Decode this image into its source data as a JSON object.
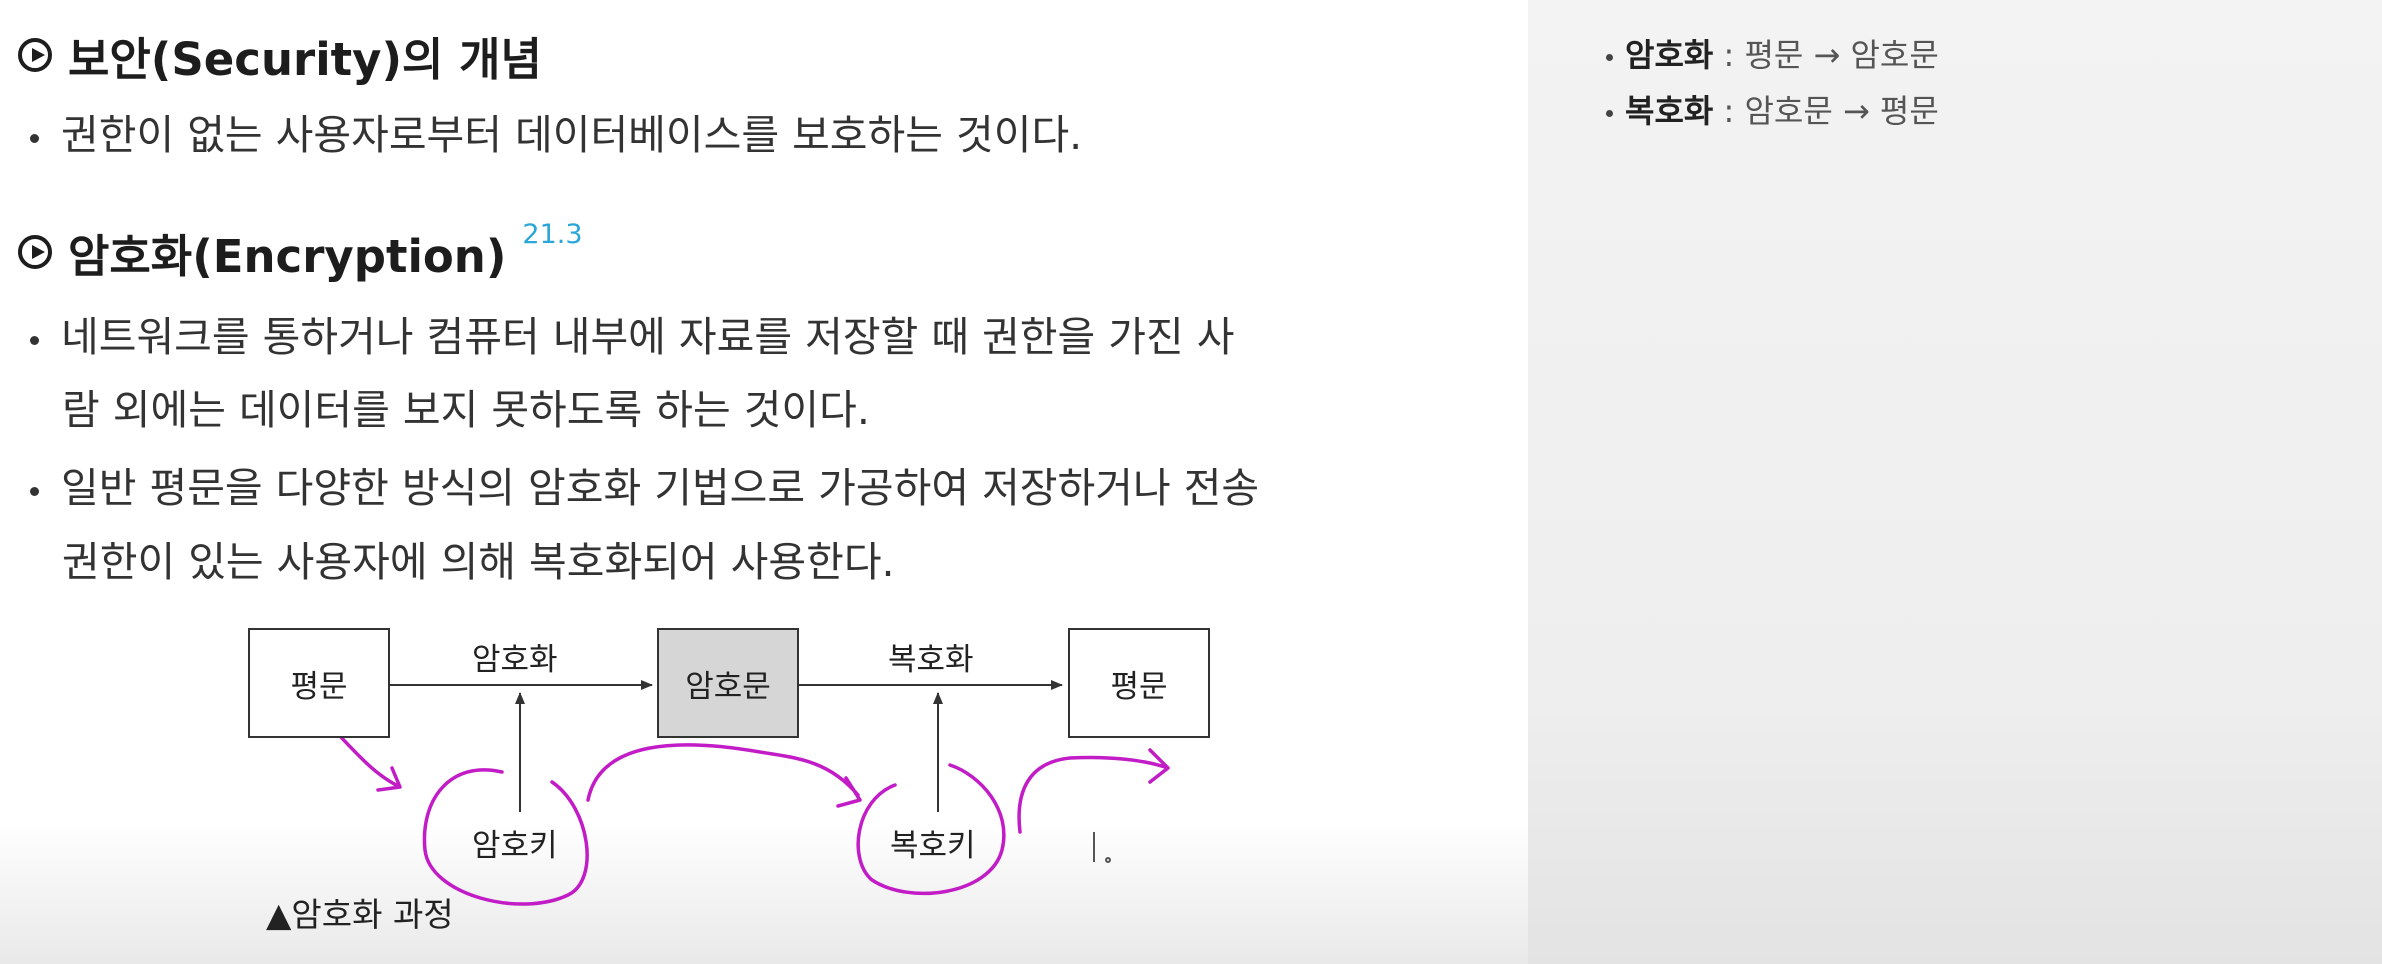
{
  "section1": {
    "title": "보안(Security)의 개념",
    "bullets": [
      "권한이 없는 사용자로부터 데이터베이스를 보호하는 것이다."
    ]
  },
  "section2": {
    "title": "암호화(Encryption)",
    "badge": "21.3",
    "bullet1": {
      "line1": "네트워크를 통하거나 컴퓨터 내부에 자료를 저장할 때 권한을 가진 사",
      "line2": "람 외에는 데이터를 보지 못하도록 하는 것이다."
    },
    "bullet2": {
      "line1": "일반 평문을 다양한 방식의 암호화 기법으로 가공하여 저장하거나 전송",
      "line2": "권한이 있는 사용자에 의해 복호화되어 사용한다."
    }
  },
  "diagram": {
    "plaintext_left": "평문",
    "encrypt_label": "암호화",
    "ciphertext": "암호문",
    "decrypt_label": "복호화",
    "plaintext_right": "평문",
    "encrypt_key": "암호키",
    "decrypt_key": "복호키",
    "caption": "▲암호화 과정",
    "annotation_color": "#c21cc7"
  },
  "side_notes": [
    {
      "term": "암호화",
      "definition": " : 평문 → 암호문"
    },
    {
      "term": "복호화",
      "definition": " : 암호문 → 평문"
    }
  ]
}
